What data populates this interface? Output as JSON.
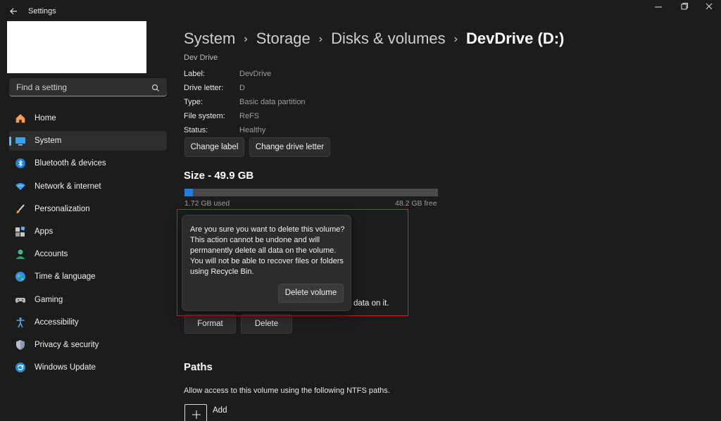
{
  "window": {
    "title": "Settings"
  },
  "search": {
    "placeholder": "Find a setting"
  },
  "sidebar": {
    "items": [
      {
        "label": "Home",
        "icon": "home-icon"
      },
      {
        "label": "System",
        "icon": "system-icon",
        "active": true
      },
      {
        "label": "Bluetooth & devices",
        "icon": "bluetooth-icon"
      },
      {
        "label": "Network & internet",
        "icon": "network-icon"
      },
      {
        "label": "Personalization",
        "icon": "brush-icon"
      },
      {
        "label": "Apps",
        "icon": "apps-icon"
      },
      {
        "label": "Accounts",
        "icon": "accounts-icon"
      },
      {
        "label": "Time & language",
        "icon": "globe-icon"
      },
      {
        "label": "Gaming",
        "icon": "gamepad-icon"
      },
      {
        "label": "Accessibility",
        "icon": "accessibility-icon"
      },
      {
        "label": "Privacy & security",
        "icon": "shield-icon"
      },
      {
        "label": "Windows Update",
        "icon": "update-icon"
      }
    ]
  },
  "breadcrumb": {
    "items": [
      "System",
      "Storage",
      "Disks & volumes"
    ],
    "current": "DevDrive (D:)"
  },
  "properties": {
    "cut_heading": "Dev Drive",
    "rows": [
      {
        "label": "Label:",
        "value": "DevDrive"
      },
      {
        "label": "Drive letter:",
        "value": "D"
      },
      {
        "label": "Type:",
        "value": "Basic data partition"
      },
      {
        "label": "File system:",
        "value": "ReFS"
      },
      {
        "label": "Status:",
        "value": "Healthy"
      }
    ],
    "change_label_button": "Change label",
    "change_letter_button": "Change drive letter"
  },
  "size": {
    "title": "Size - 49.9 GB",
    "used_text": "1.72 GB used",
    "free_text": "48.2 GB free",
    "used_fraction": 0.0345
  },
  "format_section": {
    "partial_text": "data on it.",
    "format_button": "Format",
    "delete_button": "Delete"
  },
  "flyout": {
    "message": "Are you sure you want to delete this volume? This action cannot be undone and will permanently delete all data on the volume. You will not be able to recover files or folders using Recycle Bin.",
    "confirm_button": "Delete volume"
  },
  "paths": {
    "title": "Paths",
    "description": "Allow access to this volume using the following NTFS paths.",
    "add_label": "Add"
  },
  "colors": {
    "background": "#1c1c1c",
    "accent": "#4cc2ff",
    "bar_used": "#1f7de0",
    "highlight_border": "#d0202c"
  }
}
